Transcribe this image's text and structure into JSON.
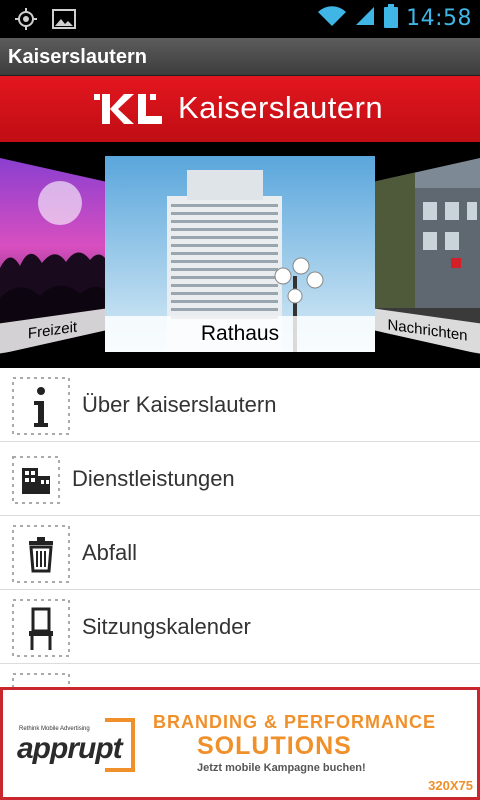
{
  "status_bar": {
    "time": "14:58"
  },
  "app": {
    "title": "Kaiserslautern"
  },
  "banner": {
    "brand": "Kaiserslautern",
    "accent": "#d7141c"
  },
  "carousel": {
    "left": {
      "caption": "Freizeit"
    },
    "center": {
      "caption": "Rathaus"
    },
    "right": {
      "caption": "Nachrichten"
    }
  },
  "menu": {
    "items": [
      {
        "label": "Über Kaiserslautern",
        "icon": "info-icon"
      },
      {
        "label": "Dienstleistungen",
        "icon": "building-icon"
      },
      {
        "label": "Abfall",
        "icon": "trash-icon"
      },
      {
        "label": "Sitzungskalender",
        "icon": "chair-icon"
      }
    ]
  },
  "ad": {
    "tagline": "Rethink Mobile Advertising",
    "logo": "apprupt",
    "headline": "BRANDING & PERFORMANCE",
    "headline2": "SOLUTIONS",
    "subline": "Jetzt mobile Kampagne buchen!",
    "size": "320X75"
  }
}
